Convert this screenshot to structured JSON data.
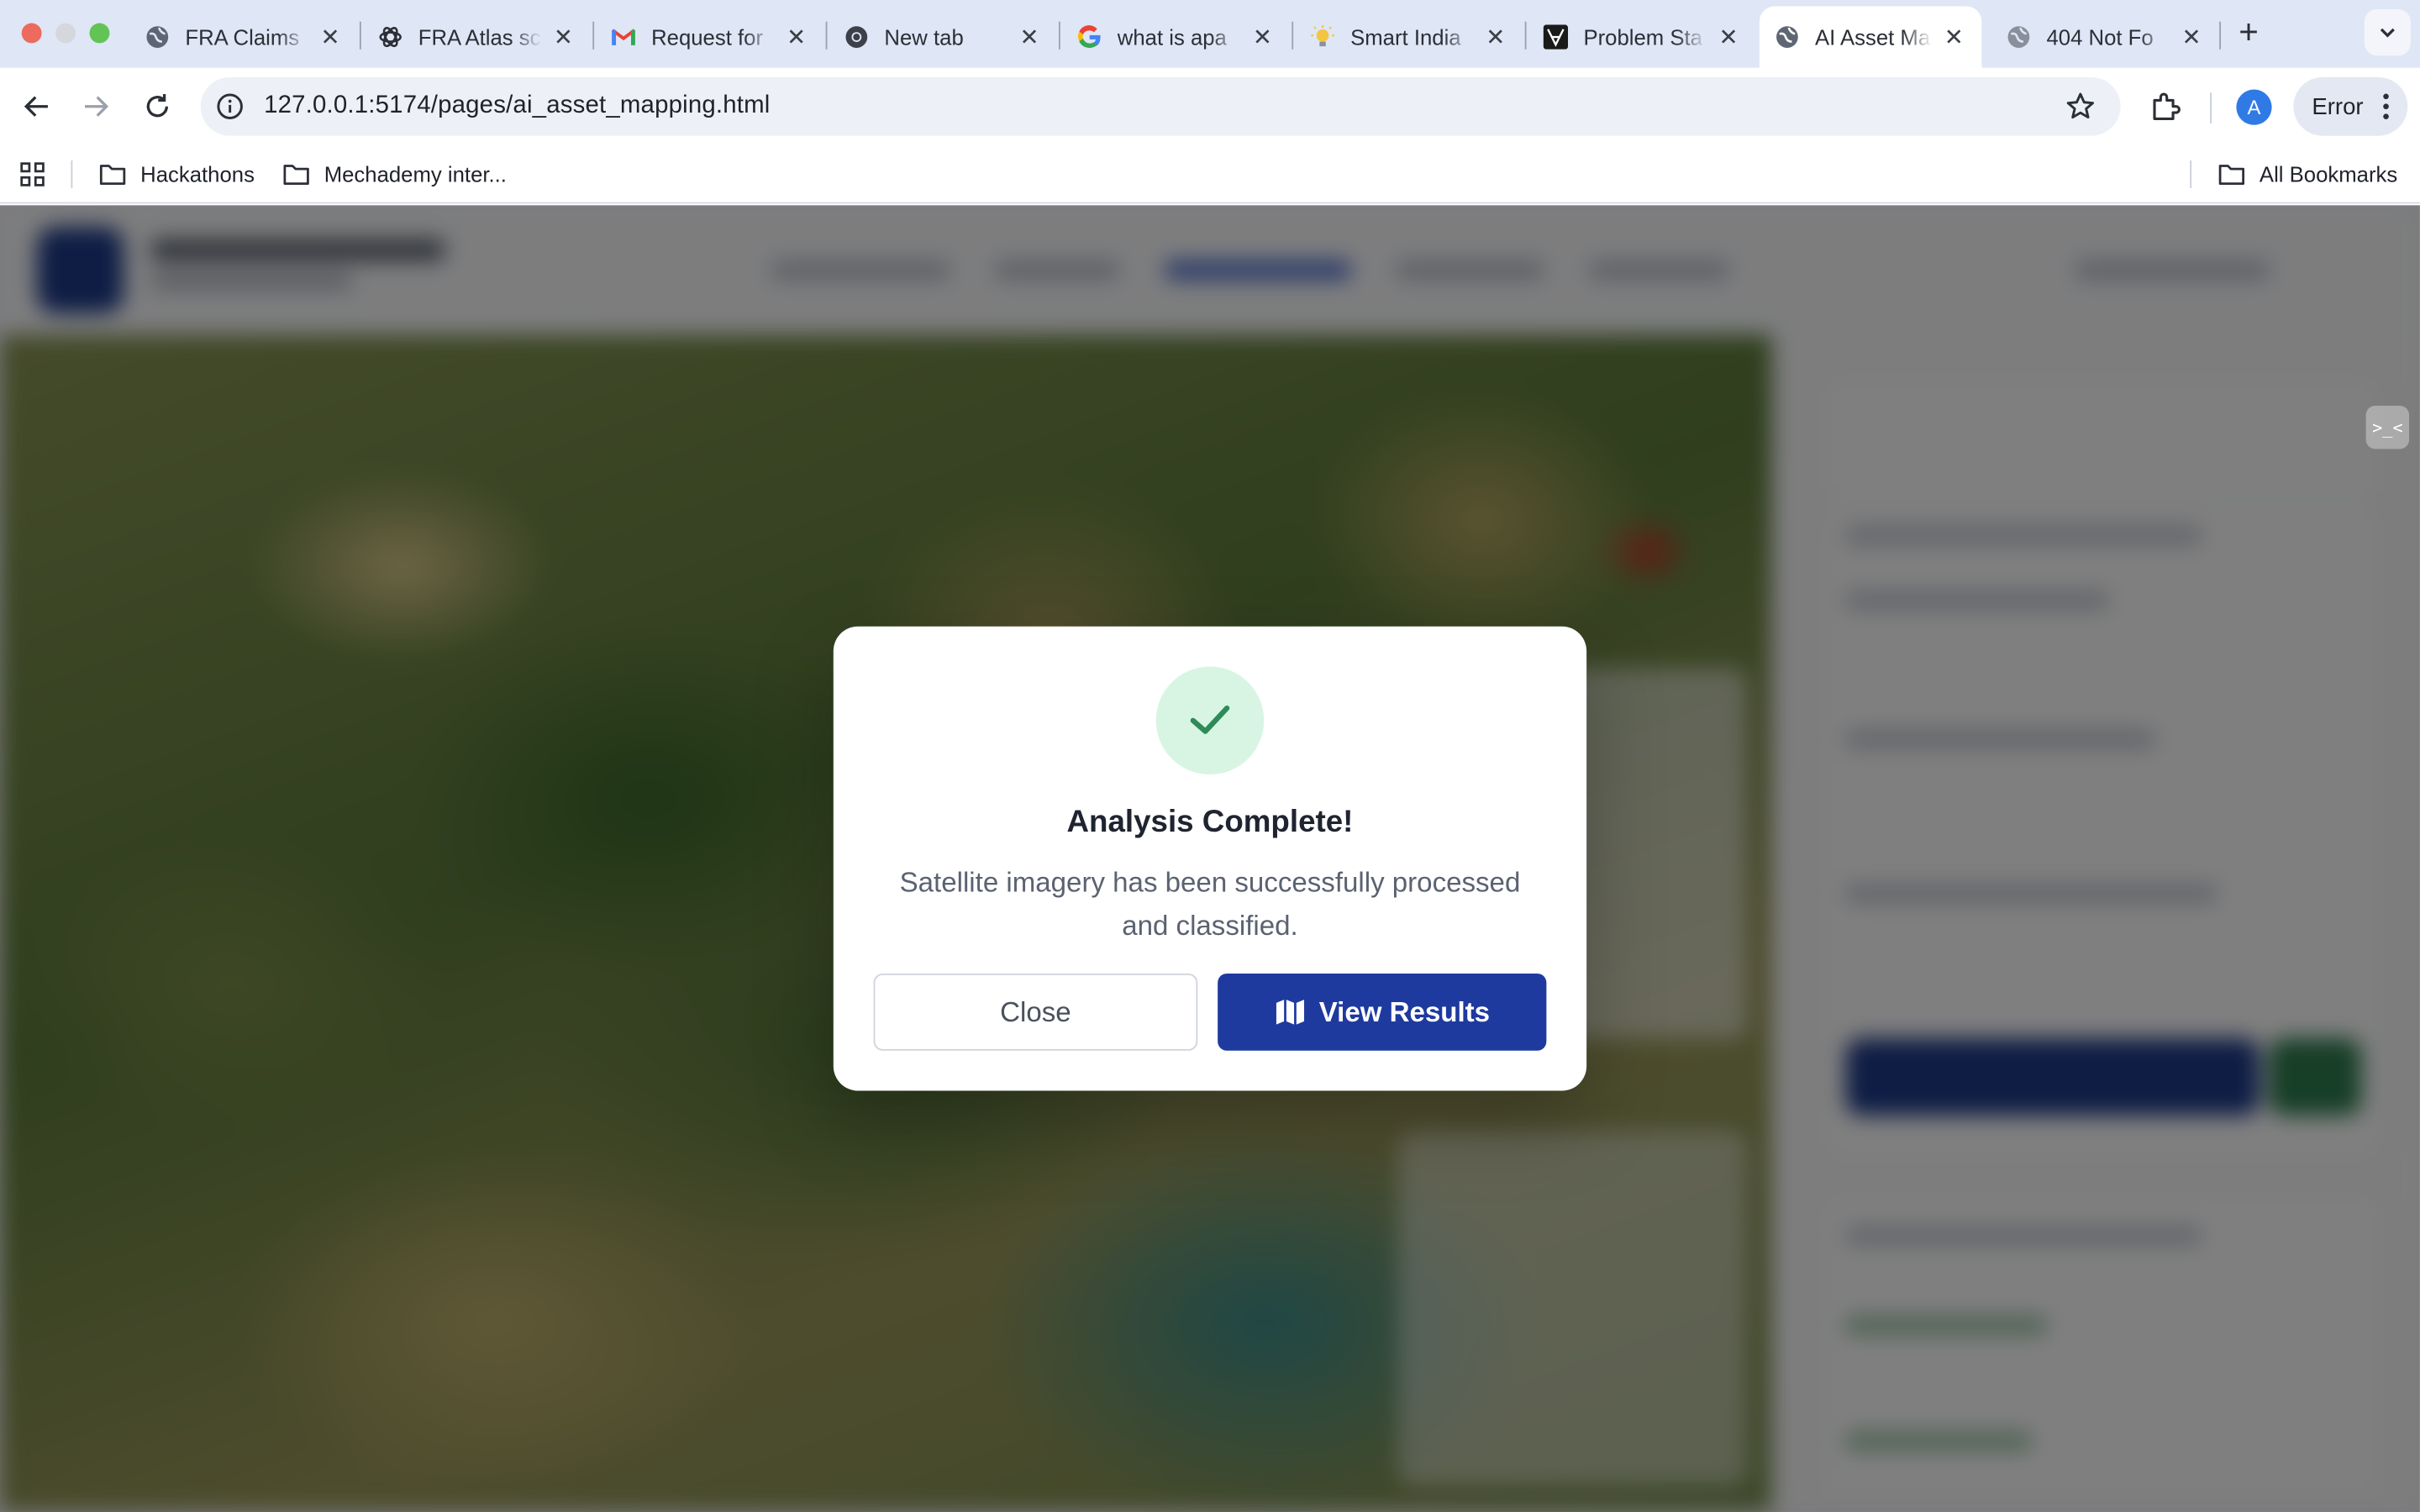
{
  "browser": {
    "tabs": [
      {
        "title": "FRA Claims",
        "icon": "globe-icon"
      },
      {
        "title": "FRA Atlas sc",
        "icon": "openai-icon"
      },
      {
        "title": "Request for",
        "icon": "gmail-icon"
      },
      {
        "title": "New tab",
        "icon": "chrome-icon"
      },
      {
        "title": "what is apa",
        "icon": "google-icon"
      },
      {
        "title": "Smart India",
        "icon": "bulb-icon"
      },
      {
        "title": "Problem Sta",
        "icon": "site-icon"
      },
      {
        "title": "AI Asset Ma",
        "icon": "globe-icon",
        "active": true
      },
      {
        "title": "404 Not Fo",
        "icon": "globe-icon"
      }
    ],
    "address": "127.0.0.1:5174/pages/ai_asset_mapping.html",
    "profile_initial": "A",
    "error_label": "Error",
    "bookmarks": [
      {
        "label": "Hackathons"
      },
      {
        "label": "Mechademy inter..."
      }
    ],
    "all_bookmarks_label": "All Bookmarks"
  },
  "page": {
    "dev_badge": ">_<"
  },
  "modal": {
    "title": "Analysis Complete!",
    "description": "Satellite imagery has been successfully processed and classified.",
    "close_label": "Close",
    "view_label": "View Results",
    "colors": {
      "primary": "#1e3a9f",
      "success_bg": "#d8f5e3",
      "success_check": "#2e8b57"
    }
  }
}
